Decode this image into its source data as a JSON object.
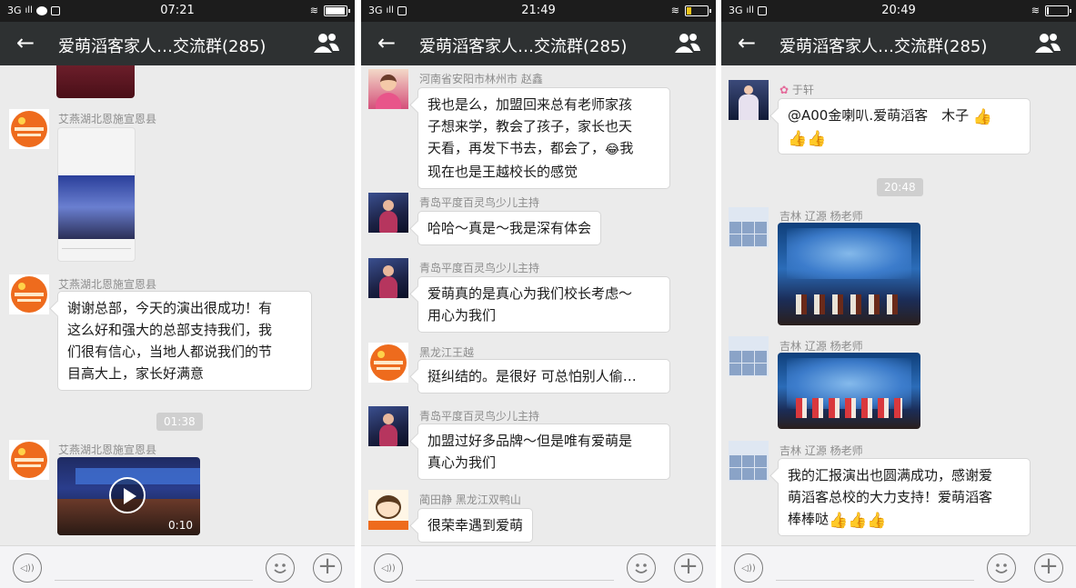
{
  "panels": [
    {
      "time": "07:21",
      "network": "3G",
      "title": "爱萌滔客家人…交流群(285)",
      "messages": [
        {
          "sender": "艾燕湖北恩施宣恩县"
        },
        {
          "sender": "艾燕湖北恩施宣恩县",
          "lines": [
            "谢谢总部，今天的演出很成功！有",
            "这么好和强大的总部支持我们，我",
            "们很有信心，当地人都说我们的节",
            "目高大上，家长好满意"
          ]
        },
        {
          "time_divider": "01:38"
        },
        {
          "sender": "艾燕湖北恩施宣恩县",
          "video_duration": "0:10"
        }
      ]
    },
    {
      "time": "21:49",
      "network": "3G",
      "title": "爱萌滔客家人…交流群(285)",
      "messages": [
        {
          "sender": "河南省安阳市林州市 赵鑫",
          "lines": [
            "我也是么，加盟回来总有老师家孩",
            "子想来学，教会了孩子，家长也天",
            "天看，再发下书去，都会了，",
            "现在也是王越校长的感觉"
          ],
          "emoji_after_line3": "😂",
          "emoji_end": "我"
        },
        {
          "sender": "青岛平度百灵鸟少儿主持",
          "lines": [
            "哈哈～真是～我是深有体会"
          ]
        },
        {
          "sender": "青岛平度百灵鸟少儿主持",
          "lines": [
            "爱萌真的是真心为我们校长考虑～",
            "用心为我们"
          ]
        },
        {
          "sender": "黑龙江王越",
          "lines": [
            "挺纠结的。是很好 可总怕别人偷…"
          ]
        },
        {
          "sender": "青岛平度百灵鸟少儿主持",
          "lines": [
            "加盟过好多品牌～但是唯有爱萌是",
            "真心为我们"
          ]
        },
        {
          "sender": "蔺田静 黑龙江双鸭山",
          "lines": [
            "很荣幸遇到爱萌"
          ]
        }
      ]
    },
    {
      "time": "20:49",
      "network": "3G",
      "title": "爱萌滔客家人…交流群(285)",
      "messages": [
        {
          "sender": "于轩",
          "lines": [
            "@A00金喇叭.爱萌滔客　木子"
          ],
          "thumbs": "👍",
          "thumbs_line2": "👍👍"
        },
        {
          "time_divider": "20:48"
        },
        {
          "sender": "吉林 辽源 杨老师"
        },
        {
          "sender": "吉林 辽源 杨老师"
        },
        {
          "sender": "吉林 辽源 杨老师",
          "lines": [
            "我的汇报演出也圆满成功，感谢爱",
            "萌滔客总校的大力支持！爱萌滔客",
            "棒棒哒"
          ],
          "thumbs": "👍👍👍"
        }
      ]
    }
  ],
  "icons": {
    "back": "←",
    "voice": "◁))",
    "plus": "+"
  },
  "colors": {
    "titlebar": "#2e3132",
    "statusbar": "#1c1c1c",
    "chat_bg": "#ebebeb",
    "bubble": "#ffffff",
    "sender_text": "#8c8c8c"
  }
}
